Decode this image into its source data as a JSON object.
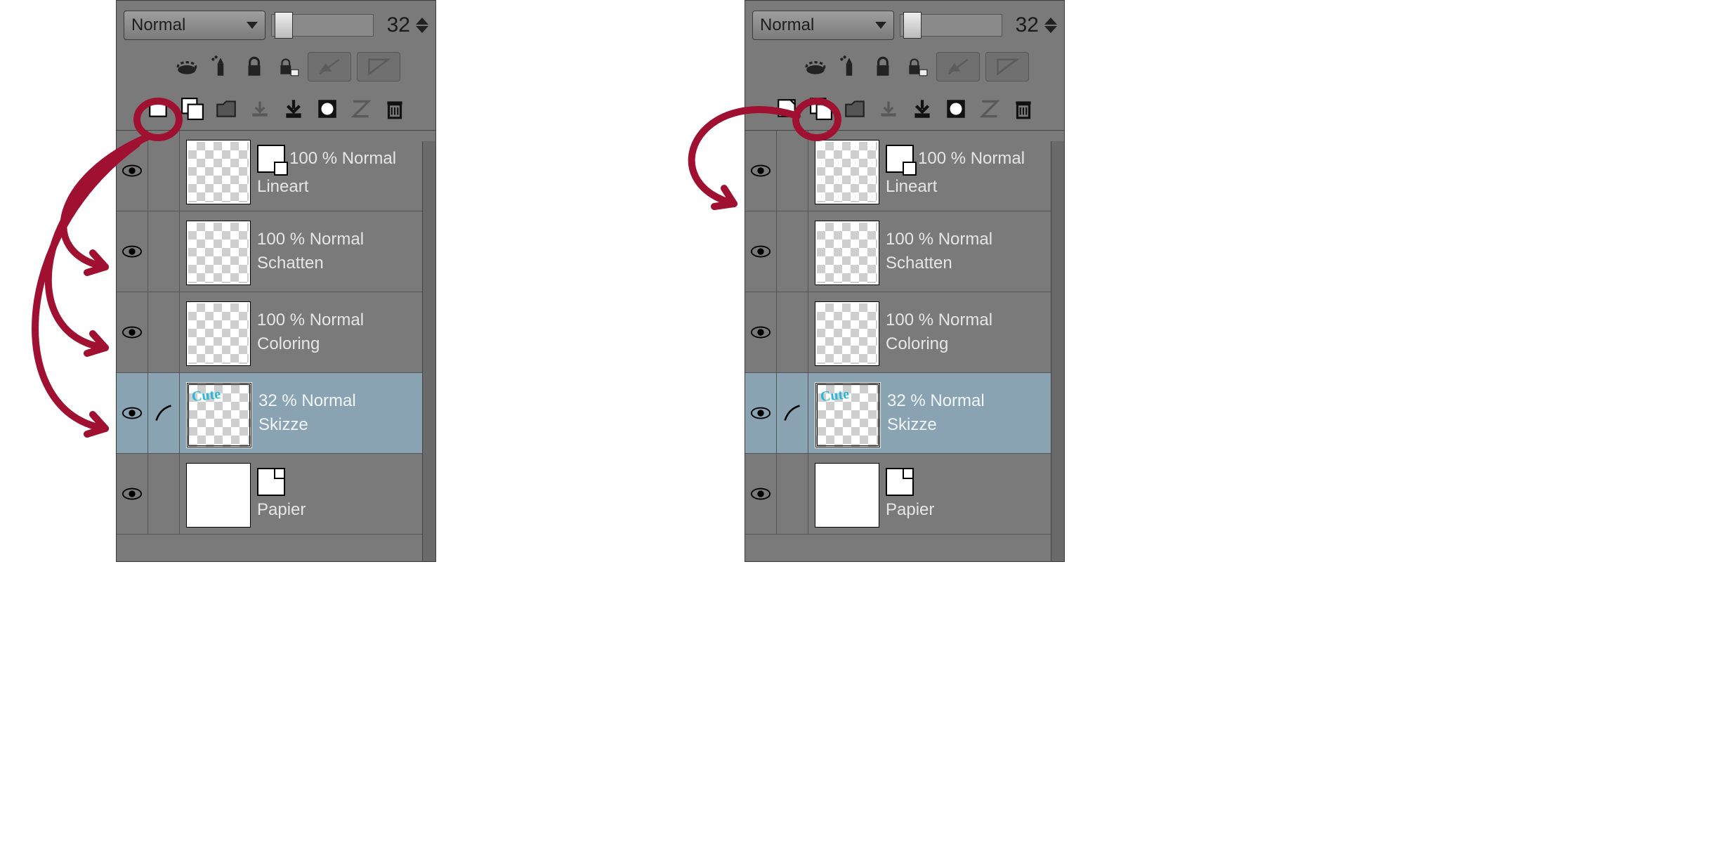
{
  "blend_mode": "Normal",
  "opacity_value": "32",
  "layers": [
    {
      "percent": "100 % Normal",
      "name": "Lineart",
      "thumb": "checker",
      "selected": false,
      "has_set_icon": true,
      "has_pen": false
    },
    {
      "percent": "100 % Normal",
      "name": "Schatten",
      "thumb": "checker",
      "selected": false,
      "has_set_icon": false,
      "has_pen": false
    },
    {
      "percent": "100 % Normal",
      "name": "Coloring",
      "thumb": "checker",
      "selected": false,
      "has_set_icon": false,
      "has_pen": false
    },
    {
      "percent": "32 % Normal",
      "name": "Skizze",
      "thumb": "cute",
      "selected": true,
      "has_set_icon": false,
      "has_pen": true
    },
    {
      "percent": "",
      "name": "Papier",
      "thumb": "white",
      "selected": false,
      "has_set_icon": false,
      "has_pen": false,
      "paper_icon": true
    }
  ],
  "tool_icons_row1": [
    "puck-icon",
    "spray-icon",
    "lock-icon",
    "lock-alpha-icon",
    "mask-disabled-icon",
    "ruler-disabled-icon"
  ],
  "tool_icons_row2": [
    "new-layer-icon",
    "new-layer-set-icon",
    "new-folder-icon",
    "down-1-icon",
    "down-2-icon",
    "mask-icon",
    "fx-icon",
    "trash-icon"
  ],
  "annotation_color": "#a01030",
  "skizze_thumb_text": "Cute"
}
